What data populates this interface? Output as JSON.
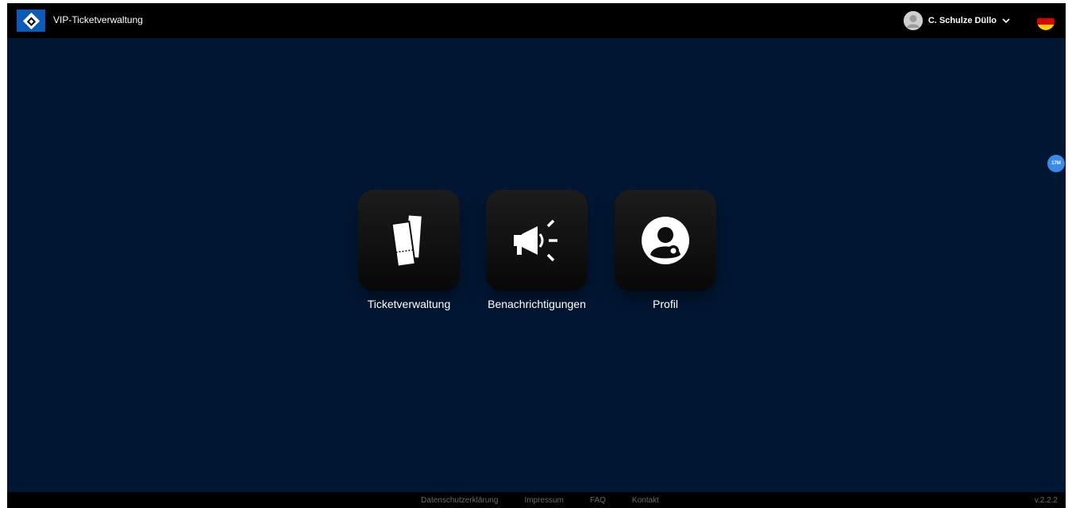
{
  "header": {
    "app_title": "VIP-Ticketverwaltung",
    "user_name": "C. Schulze Düllo",
    "logo_icon": "hsv-diamond-logo",
    "language_flag": "germany-flag",
    "flag_colors": [
      "#000000",
      "#dd0000",
      "#ffce00"
    ]
  },
  "side_badge": {
    "label": "17M"
  },
  "tiles": [
    {
      "label": "Ticketverwaltung",
      "icon": "tickets-icon"
    },
    {
      "label": "Benachrichtigungen",
      "icon": "megaphone-icon"
    },
    {
      "label": "Profil",
      "icon": "user-profile-icon"
    }
  ],
  "footer": {
    "links": [
      "Datenschutzerklärung",
      "Impressum",
      "FAQ",
      "Kontakt"
    ],
    "version": "v.2.2.2"
  },
  "colors": {
    "background": "#001733",
    "topbar": "#000000",
    "logo_blue": "#0a5cb8",
    "badge_blue": "#3a8be8"
  }
}
